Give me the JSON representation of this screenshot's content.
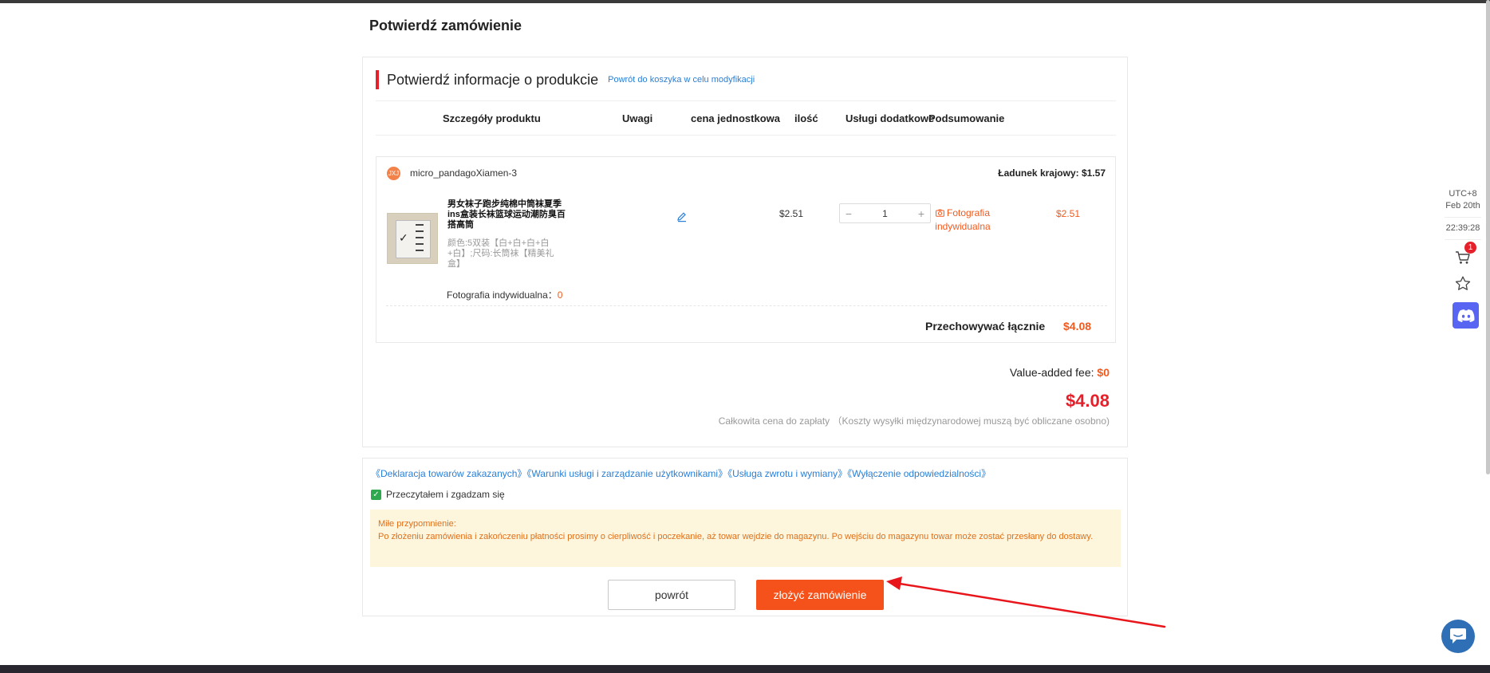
{
  "page_title": "Potwierdź zamówienie",
  "product_section": {
    "title": "Potwierdź informacje o produkcie",
    "back_link": "Powrót do koszyka w celu modyfikacji",
    "columns": [
      "Szczegóły produktu",
      "Uwagi",
      "cena jednostkowa",
      "ilość",
      "Usługi dodatkowe",
      "Podsumowanie"
    ]
  },
  "store": {
    "logo_text": "JXJ",
    "name": "micro_pandagoXiamen-3",
    "shipping": "Ładunek krajowy: $1.57",
    "item": {
      "name": "男女袜子跑步纯棉中筒袜夏季ins盒装长袜篮球运动潮防臭百搭高筒",
      "attributes": "颜色:5双装【白+白+白+白+白】;尺码:长筒袜【精美礼盒】",
      "unit_price": "$2.51",
      "quantity": "1",
      "qty_minus": "−",
      "qty_plus": "+",
      "addon_service": "Fotografia indywidualna",
      "subtotal": "$2.51",
      "photo_label": "Fotografia indywidualna：",
      "photo_count": "0"
    },
    "total_label": "Przechowywać łącznie",
    "total_value": "$4.08"
  },
  "totals": {
    "vat_label": "Value-added fee:",
    "vat_value": "$0",
    "grand_total": "$4.08",
    "grand_note": "Całkowita cena do zapłaty （Koszty wysyłki międzynarodowej muszą być obliczane osobno)"
  },
  "terms": {
    "links": [
      "《Deklaracja towarów zakazanych》",
      "《Warunki usługi i zarządzanie użytkownikami》",
      "《Usługa zwrotu i wymiany》",
      "《Wyłączenie odpowiedzialności》"
    ],
    "agree_label": "Przeczytałem i zgadzam się",
    "checkmark": "✓"
  },
  "notice": {
    "title": "Miłe przypomnienie:",
    "body": "Po złożeniu zamówienia i zakończeniu płatności prosimy o cierpliwość i poczekanie, aż towar wejdzie do magazynu. Po wejściu do magazynu towar może zostać przesłany do dostawy."
  },
  "buttons": {
    "back": "powrót",
    "place_order": "złożyć zamówienie"
  },
  "sidebar": {
    "timezone": "UTC+8",
    "date": "Feb 20th",
    "time": "22:39:28",
    "cart_badge": "1"
  },
  "colors": {
    "accent_orange": "#f5511a",
    "price_orange": "#f25a1e",
    "total_red": "#e5202a",
    "link_blue": "#2a7fd6",
    "annotation_arrow": "#e8151b"
  }
}
